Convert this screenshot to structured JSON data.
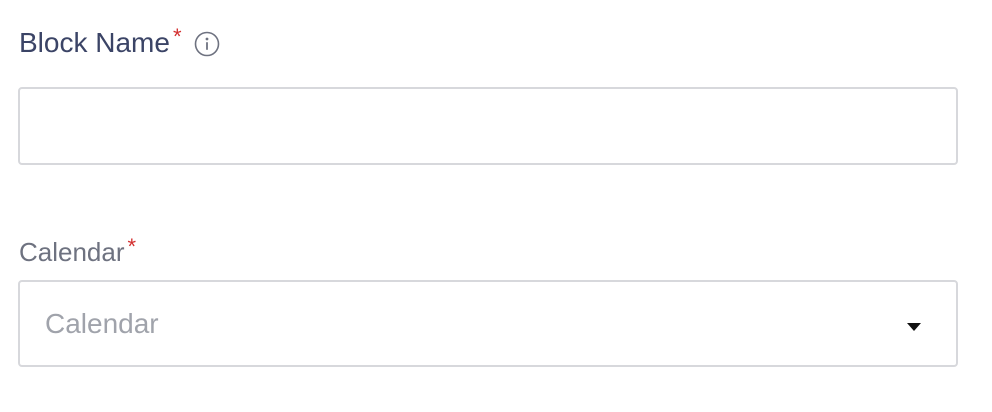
{
  "block_name": {
    "label": "Block Name",
    "required_mark": "*",
    "info_icon": "info-icon",
    "value": ""
  },
  "calendar": {
    "label": "Calendar",
    "required_mark": "*",
    "placeholder": "Calendar",
    "caret_icon": "chevron-down-icon"
  },
  "colors": {
    "label_primary": "#3b4466",
    "label_secondary": "#6e7280",
    "required": "#d32f2f",
    "border": "#d7d8dc",
    "placeholder": "#a0a3ab"
  }
}
